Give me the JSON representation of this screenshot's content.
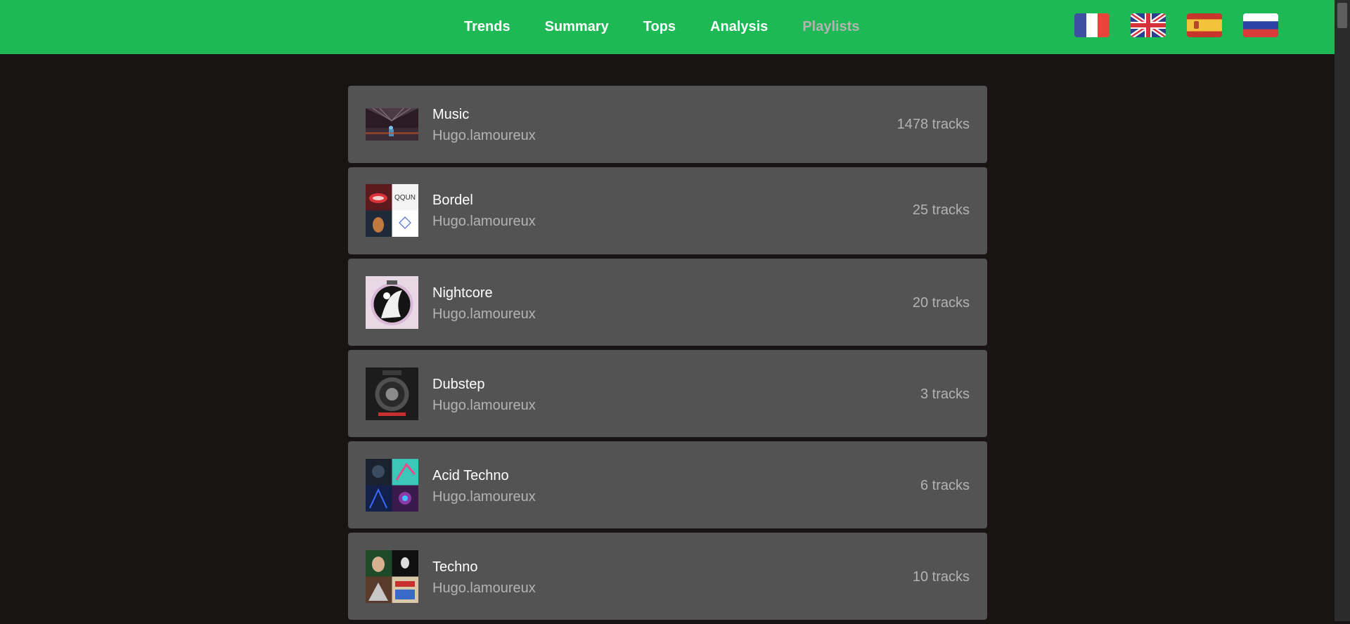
{
  "nav": {
    "links": [
      {
        "label": "Trends"
      },
      {
        "label": "Summary"
      },
      {
        "label": "Tops"
      },
      {
        "label": "Analysis"
      },
      {
        "label": "Playlists",
        "active": true
      }
    ]
  },
  "languages": [
    {
      "name": "french-flag-icon"
    },
    {
      "name": "uk-flag-icon"
    },
    {
      "name": "spain-flag-icon"
    },
    {
      "name": "russia-flag-icon"
    }
  ],
  "colors": {
    "accent": "#1db954",
    "page_background": "#181414",
    "card_background": "#535353",
    "muted_text": "#b3b3b3"
  },
  "playlists": [
    {
      "title": "Music",
      "owner": "Hugo.lamoureux",
      "tracks": "1478 tracks"
    },
    {
      "title": "Bordel",
      "owner": "Hugo.lamoureux",
      "tracks": "25 tracks"
    },
    {
      "title": "Nightcore",
      "owner": "Hugo.lamoureux",
      "tracks": "20 tracks"
    },
    {
      "title": "Dubstep",
      "owner": "Hugo.lamoureux",
      "tracks": "3 tracks"
    },
    {
      "title": "Acid Techno",
      "owner": "Hugo.lamoureux",
      "tracks": "6 tracks"
    },
    {
      "title": "Techno",
      "owner": "Hugo.lamoureux",
      "tracks": "10 tracks"
    }
  ]
}
